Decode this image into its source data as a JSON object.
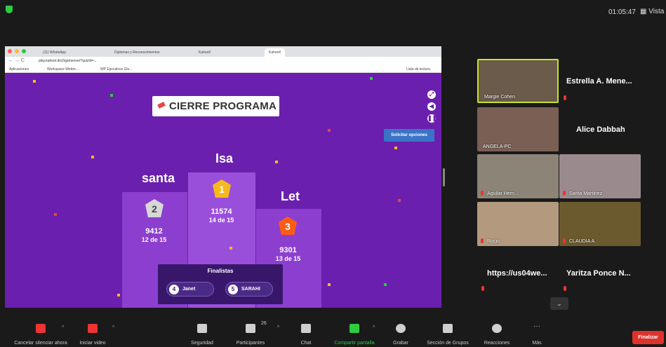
{
  "topbar": {
    "clock": "01:05:47",
    "view_label": "Vista"
  },
  "browser": {
    "tabs": [
      "(11) WhatsApp",
      "Diplomas y Reconocimientos",
      "Kahoot!",
      "Kahoot!"
    ],
    "url": "play.kahoot.it/v2/gameover?quizId=...",
    "bookmarks": [
      "Aplicaciones",
      "Workspace Webm...",
      "WP Ejecutivos Glo..."
    ],
    "reading_list": "Lista de lectura"
  },
  "game": {
    "title": "CIERRE PROGRAMA",
    "request_button": "Solicitar opciones",
    "podium": [
      {
        "rank": "2",
        "name": "santa",
        "score": "9412",
        "correct": "12 de 15"
      },
      {
        "rank": "1",
        "name": "Isa",
        "score": "11574",
        "correct": "14 de 15"
      },
      {
        "rank": "3",
        "name": "Let",
        "score": "9301",
        "correct": "13 de 15"
      }
    ],
    "finalists_label": "Finalistas",
    "finalists": [
      {
        "rank": "4",
        "name": "Janet"
      },
      {
        "rank": "5",
        "name": "SARAHI"
      }
    ]
  },
  "participants": [
    {
      "label": "Margie Cohen",
      "type": "video"
    },
    {
      "label": "Estrella A. Mene...",
      "type": "name"
    },
    {
      "label": "ANGELA-PC",
      "type": "video"
    },
    {
      "label": "Alice Dabbah",
      "type": "name"
    },
    {
      "label": "Aguilar Hern...",
      "type": "video"
    },
    {
      "label": "Sarita Martinez",
      "type": "video"
    },
    {
      "label": "Rocio",
      "type": "video"
    },
    {
      "label": "CLAUDIA A.",
      "type": "video"
    },
    {
      "label": "https://us04we...",
      "type": "name"
    },
    {
      "label": "Yaritza Ponce N...",
      "type": "name"
    }
  ],
  "toolbar": {
    "mute": "Cancelar silenciar ahora",
    "video": "Iniciar video",
    "security": "Seguridad",
    "participants": "Participantes",
    "participants_count": "26",
    "chat": "Chat",
    "share": "Compartir pantalla",
    "record": "Grabar",
    "breakout": "Sección de Grupos",
    "reactions": "Reacciones",
    "more": "Más",
    "end": "Finalizar"
  },
  "colors": {
    "kahoot_purple": "#6b1fae",
    "share_green": "#2ecc40",
    "end_red": "#e0322d",
    "speaker_border": "#c9e22a"
  }
}
